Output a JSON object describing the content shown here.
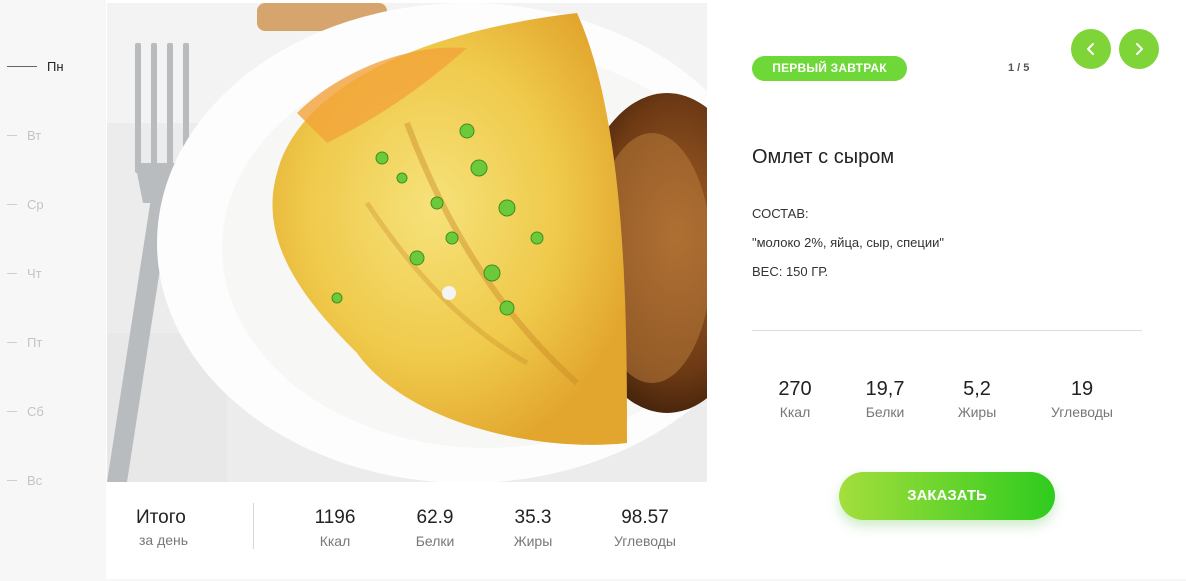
{
  "days": [
    {
      "label": "Пн",
      "active": true
    },
    {
      "label": "Вт",
      "active": false
    },
    {
      "label": "Ср",
      "active": false
    },
    {
      "label": "Чт",
      "active": false
    },
    {
      "label": "Пт",
      "active": false
    },
    {
      "label": "Сб",
      "active": false
    },
    {
      "label": "Вс",
      "active": false
    }
  ],
  "meal": {
    "badge": "ПЕРВЫЙ ЗАВТРАК",
    "counter": "1 / 5",
    "name": "Омлет с сыром",
    "composition_heading": "СОСТАВ:",
    "composition": "\"молоко 2%, яйца, сыр, специи\"",
    "weight": "ВЕС: 150 ГР.",
    "nutrients": [
      {
        "value": "270",
        "label": "Ккал"
      },
      {
        "value": "19,7",
        "label": "Белки"
      },
      {
        "value": "5,2",
        "label": "Жиры"
      },
      {
        "value": "19",
        "label": "Углеводы"
      }
    ],
    "order_label": "ЗАКАЗАТЬ",
    "prev_icon": "chevron-left-icon",
    "next_icon": "chevron-right-icon"
  },
  "totals": {
    "title": "Итого",
    "subtitle": "за день",
    "items": [
      {
        "value": "1196",
        "label": "Ккал"
      },
      {
        "value": "62.9",
        "label": "Белки"
      },
      {
        "value": "35.3",
        "label": "Жиры"
      },
      {
        "value": "98.57",
        "label": "Углеводы"
      }
    ]
  },
  "colors": {
    "accent": "#7fd437",
    "badge": "#6fd839",
    "order_gradient_start": "#a4de3c",
    "order_gradient_end": "#2ecb1e"
  }
}
